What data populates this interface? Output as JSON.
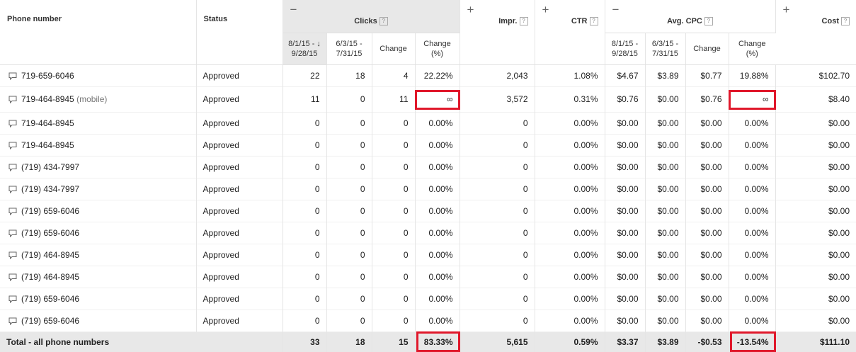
{
  "headers": {
    "phone": "Phone number",
    "status": "Status",
    "clicks": "Clicks",
    "impr": "Impr.",
    "ctr": "CTR",
    "avg_cpc": "Avg. CPC",
    "cost": "Cost",
    "help": "?",
    "collapse": "−",
    "expand": "+",
    "sort_arrow": "↓",
    "sub": {
      "range1_a": "8/1/15 -",
      "range1_b": "9/28/15",
      "range2_a": "6/3/15 -",
      "range2_b": "7/31/15",
      "change": "Change",
      "change_pct_a": "Change",
      "change_pct_b": "(%)"
    }
  },
  "rows": [
    {
      "phone": "719-659-6046",
      "suffix": "",
      "status": "Approved",
      "c1": "22",
      "c2": "18",
      "cch": "4",
      "cpct": "22.22%",
      "impr": "2,043",
      "ctr": "1.08%",
      "p1": "$4.67",
      "p2": "$3.89",
      "pch": "$0.77",
      "ppct": "19.88%",
      "cost": "$102.70"
    },
    {
      "phone": "719-464-8945",
      "suffix": "(mobile)",
      "status": "Approved",
      "c1": "11",
      "c2": "0",
      "cch": "11",
      "cpct": "∞",
      "impr": "3,572",
      "ctr": "0.31%",
      "p1": "$0.76",
      "p2": "$0.00",
      "pch": "$0.76",
      "ppct": "∞",
      "cost": "$8.40"
    },
    {
      "phone": "719-464-8945",
      "suffix": "",
      "status": "Approved",
      "c1": "0",
      "c2": "0",
      "cch": "0",
      "cpct": "0.00%",
      "impr": "0",
      "ctr": "0.00%",
      "p1": "$0.00",
      "p2": "$0.00",
      "pch": "$0.00",
      "ppct": "0.00%",
      "cost": "$0.00"
    },
    {
      "phone": "719-464-8945",
      "suffix": "",
      "status": "Approved",
      "c1": "0",
      "c2": "0",
      "cch": "0",
      "cpct": "0.00%",
      "impr": "0",
      "ctr": "0.00%",
      "p1": "$0.00",
      "p2": "$0.00",
      "pch": "$0.00",
      "ppct": "0.00%",
      "cost": "$0.00"
    },
    {
      "phone": "(719) 434-7997",
      "suffix": "",
      "status": "Approved",
      "c1": "0",
      "c2": "0",
      "cch": "0",
      "cpct": "0.00%",
      "impr": "0",
      "ctr": "0.00%",
      "p1": "$0.00",
      "p2": "$0.00",
      "pch": "$0.00",
      "ppct": "0.00%",
      "cost": "$0.00"
    },
    {
      "phone": "(719) 434-7997",
      "suffix": "",
      "status": "Approved",
      "c1": "0",
      "c2": "0",
      "cch": "0",
      "cpct": "0.00%",
      "impr": "0",
      "ctr": "0.00%",
      "p1": "$0.00",
      "p2": "$0.00",
      "pch": "$0.00",
      "ppct": "0.00%",
      "cost": "$0.00"
    },
    {
      "phone": "(719) 659-6046",
      "suffix": "",
      "status": "Approved",
      "c1": "0",
      "c2": "0",
      "cch": "0",
      "cpct": "0.00%",
      "impr": "0",
      "ctr": "0.00%",
      "p1": "$0.00",
      "p2": "$0.00",
      "pch": "$0.00",
      "ppct": "0.00%",
      "cost": "$0.00"
    },
    {
      "phone": "(719) 659-6046",
      "suffix": "",
      "status": "Approved",
      "c1": "0",
      "c2": "0",
      "cch": "0",
      "cpct": "0.00%",
      "impr": "0",
      "ctr": "0.00%",
      "p1": "$0.00",
      "p2": "$0.00",
      "pch": "$0.00",
      "ppct": "0.00%",
      "cost": "$0.00"
    },
    {
      "phone": "(719) 464-8945",
      "suffix": "",
      "status": "Approved",
      "c1": "0",
      "c2": "0",
      "cch": "0",
      "cpct": "0.00%",
      "impr": "0",
      "ctr": "0.00%",
      "p1": "$0.00",
      "p2": "$0.00",
      "pch": "$0.00",
      "ppct": "0.00%",
      "cost": "$0.00"
    },
    {
      "phone": "(719) 464-8945",
      "suffix": "",
      "status": "Approved",
      "c1": "0",
      "c2": "0",
      "cch": "0",
      "cpct": "0.00%",
      "impr": "0",
      "ctr": "0.00%",
      "p1": "$0.00",
      "p2": "$0.00",
      "pch": "$0.00",
      "ppct": "0.00%",
      "cost": "$0.00"
    },
    {
      "phone": "(719) 659-6046",
      "suffix": "",
      "status": "Approved",
      "c1": "0",
      "c2": "0",
      "cch": "0",
      "cpct": "0.00%",
      "impr": "0",
      "ctr": "0.00%",
      "p1": "$0.00",
      "p2": "$0.00",
      "pch": "$0.00",
      "ppct": "0.00%",
      "cost": "$0.00"
    },
    {
      "phone": "(719) 659-6046",
      "suffix": "",
      "status": "Approved",
      "c1": "0",
      "c2": "0",
      "cch": "0",
      "cpct": "0.00%",
      "impr": "0",
      "ctr": "0.00%",
      "p1": "$0.00",
      "p2": "$0.00",
      "pch": "$0.00",
      "ppct": "0.00%",
      "cost": "$0.00"
    }
  ],
  "total": {
    "label": "Total - all phone numbers",
    "c1": "33",
    "c2": "18",
    "cch": "15",
    "cpct": "83.33%",
    "impr": "5,615",
    "ctr": "0.59%",
    "p1": "$3.37",
    "p2": "$3.89",
    "pch": "-$0.53",
    "ppct": "-13.54%",
    "cost": "$111.10"
  },
  "colors": {
    "highlight_border": "#e0182b",
    "sorted_header_bg": "#e8e8e8",
    "total_row_bg": "#e8e8e8"
  },
  "icons": {
    "phone_call": "speech-bubble-icon"
  }
}
